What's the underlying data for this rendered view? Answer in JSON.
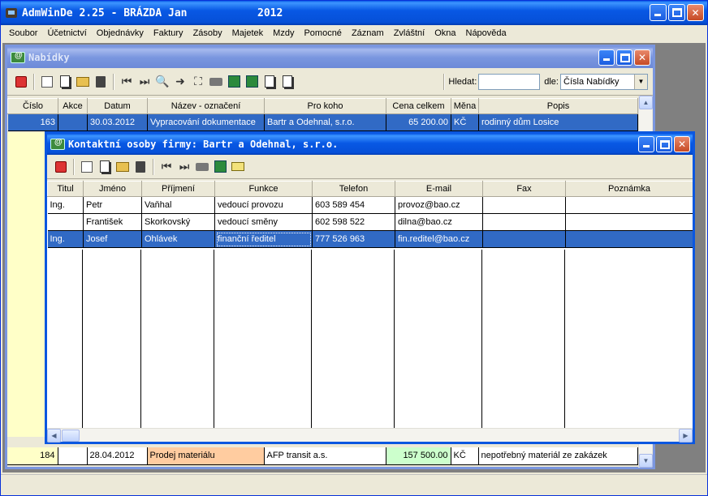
{
  "app": {
    "title": "AdmWinDe 2.25 - BRÁZDA Jan",
    "year": "2012",
    "menu": [
      "Soubor",
      "Účetnictví",
      "Objednávky",
      "Faktury",
      "Zásoby",
      "Majetek",
      "Mzdy",
      "Pomocné",
      "Záznam",
      "Zvláštní",
      "Okna",
      "Nápověda"
    ]
  },
  "nabidky": {
    "title": "Nabídky",
    "search_label": "Hledat:",
    "search_value": "",
    "by_label": "dle:",
    "by_value": "Čísla Nabídky",
    "columns": [
      "Číslo",
      "Akce",
      "Datum",
      "Název - označení",
      "Pro koho",
      "Cena celkem",
      "Měna",
      "Popis"
    ],
    "row_top": {
      "cislo": "163",
      "akce": "",
      "datum": "30.03.2012",
      "nazev": "Vypracování dokumentace",
      "pro_koho": "Bartr a Odehnal, s.r.o.",
      "cena": "65 200.00",
      "mena": "KČ",
      "popis": "rodinný dům Losice"
    },
    "row_bottom": {
      "cislo": "184",
      "akce": "",
      "datum": "28.04.2012",
      "nazev": "Prodej materiálu",
      "pro_koho": "AFP transit a.s.",
      "cena": "157 500.00",
      "mena": "KČ",
      "popis": "nepotřebný materiál ze zakázek"
    }
  },
  "kontakty": {
    "title": "Kontaktní osoby firmy: Bartr a Odehnal, s.r.o.",
    "columns": [
      "Titul",
      "Jméno",
      "Příjmení",
      "Funkce",
      "Telefon",
      "E-mail",
      "Fax",
      "Poznámka"
    ],
    "rows": [
      {
        "titul": "Ing.",
        "jmeno": "Petr",
        "prijmeni": "Vaňhal",
        "funkce": "vedoucí provozu",
        "telefon": "603 589 454",
        "email": "provoz@bao.cz",
        "fax": "",
        "poznamka": ""
      },
      {
        "titul": "",
        "jmeno": "František",
        "prijmeni": "Skorkovský",
        "funkce": "vedoucí směny",
        "telefon": "602 598 522",
        "email": "dilna@bao.cz",
        "fax": "",
        "poznamka": ""
      },
      {
        "titul": "Ing.",
        "jmeno": "Josef",
        "prijmeni": "Ohlávek",
        "funkce": "finanční ředitel",
        "telefon": "777 526 963",
        "email": "fin.reditel@bao.cz",
        "fax": "",
        "poznamka": ""
      }
    ]
  },
  "colors": {
    "titlebar": "#0858e4",
    "selection": "#316ac5",
    "yellow_cell": "#ffffc8",
    "peach_cell": "#ffcca0",
    "green_cell": "#ccffcc"
  }
}
